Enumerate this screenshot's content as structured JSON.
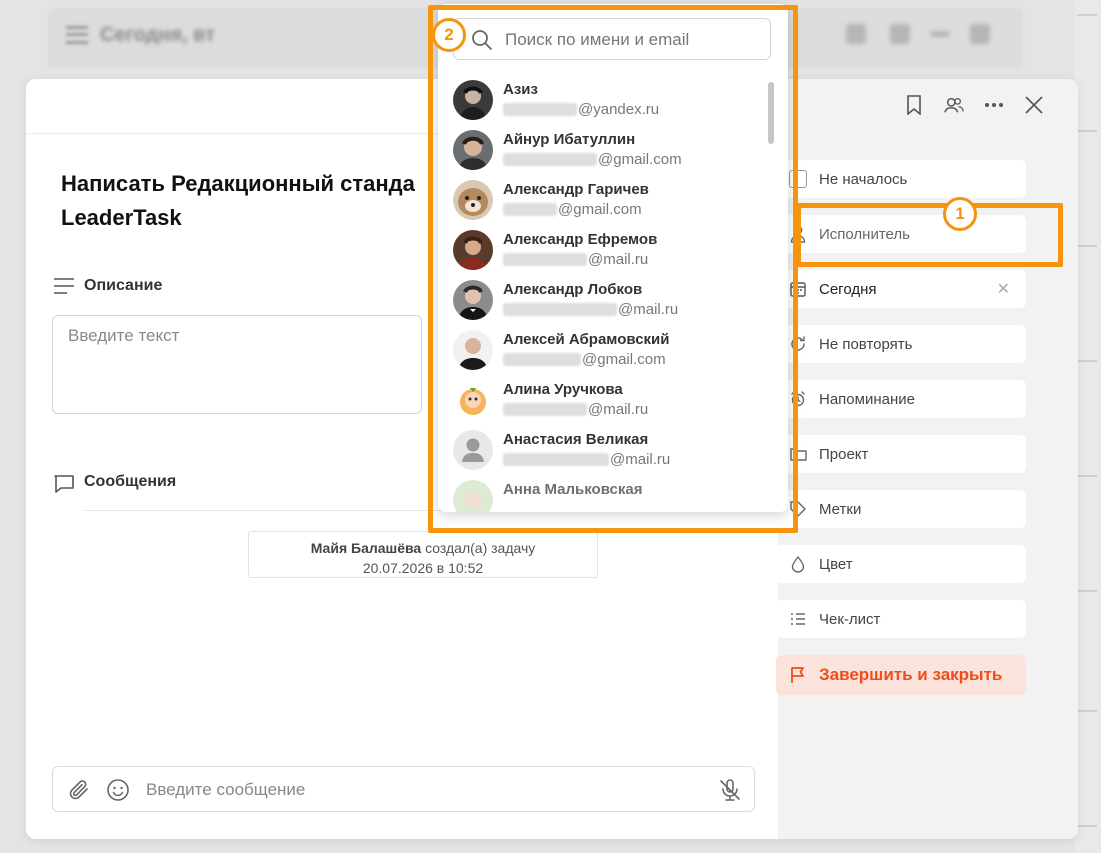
{
  "background": {
    "title": "Сегодня, вт"
  },
  "task": {
    "title": "Написать Редакционный станда LeaderTask",
    "description_label": "Описание",
    "description_placeholder": "Введите текст",
    "messages_label": "Сообщения",
    "created_author": "Майя Балашёва",
    "created_action": "создал(а) задачу",
    "created_time": "20.07.2026 в 10:52",
    "message_placeholder": "Введите сообщение"
  },
  "side": {
    "status": "Не началось",
    "assignee": "Исполнитель",
    "date": "Сегодня",
    "repeat": "Не повторять",
    "reminder": "Напоминание",
    "project": "Проект",
    "tags": "Метки",
    "color": "Цвет",
    "checklist": "Чек-лист",
    "finish": "Завершить и закрыть"
  },
  "dropdown": {
    "search_placeholder": "Поиск по имени и email",
    "people": [
      {
        "name": "Азиз",
        "email": "@yandex.ru"
      },
      {
        "name": "Айнур Ибатуллин",
        "email": "@gmail.com"
      },
      {
        "name": "Александр Гаричев",
        "email": "@gmail.com"
      },
      {
        "name": "Александр Ефремов",
        "email": "@mail.ru"
      },
      {
        "name": "Александр Лобков",
        "email": "@mail.ru"
      },
      {
        "name": "Алексей Абрамовский",
        "email": "@gmail.com"
      },
      {
        "name": "Алина Уручкова",
        "email": "@mail.ru"
      },
      {
        "name": "Анастасия Великая",
        "email": "@mail.ru"
      },
      {
        "name": "Анна Мальковская",
        "email": ""
      }
    ]
  },
  "annotations": {
    "badge_1": "1",
    "badge_2": "2",
    "color": "#f5940f"
  },
  "colors": {
    "accent": "#f5940f",
    "finish_text": "#f04d1b",
    "finish_bg": "#fbe3dc"
  }
}
